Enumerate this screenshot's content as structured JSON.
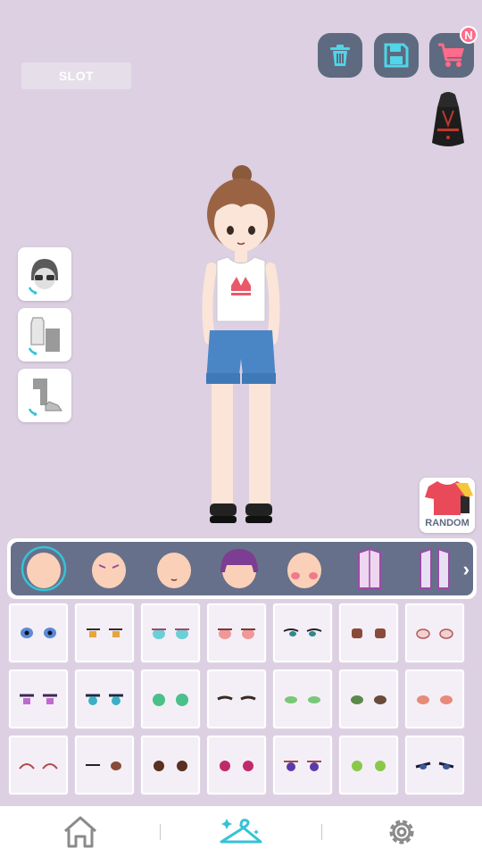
{
  "header": {
    "slot_label": "SLOT",
    "new_badge": "N"
  },
  "buttons": {
    "random_label": "RANDOM"
  },
  "categories": [
    {
      "name": "face-base",
      "selected": true
    },
    {
      "name": "eyes",
      "selected": false
    },
    {
      "name": "mouth",
      "selected": false
    },
    {
      "name": "hair",
      "selected": false
    },
    {
      "name": "blush",
      "selected": false
    },
    {
      "name": "top",
      "selected": false
    },
    {
      "name": "outerwear",
      "selected": false
    }
  ],
  "colors": {
    "background": "#dcd0e2",
    "button_dark": "#5e6a80",
    "accent_teal": "#36c2d6",
    "badge_pink": "#ff6b8a"
  },
  "nav": {
    "items": [
      "home-icon",
      "hanger-icon",
      "settings-icon"
    ],
    "active": "hanger-icon"
  }
}
